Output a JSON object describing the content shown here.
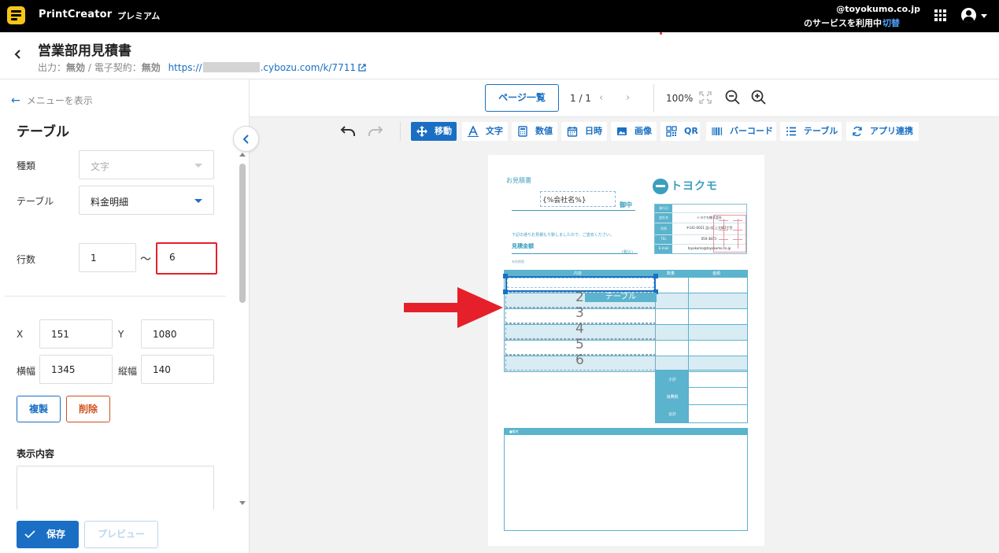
{
  "topbar": {
    "brand": "PrintCreator",
    "plan": "プレミアム",
    "user_email": "@toyokumo.co.jp",
    "service_text": "のサービスを利用中",
    "switch_label": "切替"
  },
  "header": {
    "title": "営業部用見積書",
    "output_label": "出力：",
    "output_value": "無効",
    "contract_label": " / 電子契約：",
    "contract_value": "無効",
    "url_prefix": "https://",
    "url_suffix": ".cybozu.com/k/7711"
  },
  "panel": {
    "menu_link": "メニューを表示",
    "title": "テーブル",
    "type_label": "種類",
    "type_value": "文字",
    "table_label": "テーブル",
    "table_value": "料金明細",
    "rows_label": "行数",
    "rows_from": "1",
    "rows_tilde": "〜",
    "rows_to": "6",
    "x_label": "X",
    "x_value": "151",
    "y_label": "Y",
    "y_value": "1080",
    "width_label": "横幅",
    "width_value": "1345",
    "height_label": "縦幅",
    "height_value": "140",
    "duplicate_label": "複製",
    "delete_label": "削除",
    "content_title": "表示内容",
    "save_label": "保存",
    "preview_label": "プレビュー"
  },
  "toolbar": {
    "pages_label": "ページ一覧",
    "page_count": "1 / 1",
    "zoom": "100%",
    "tools": [
      {
        "label": "移動",
        "icon": "move-icon",
        "active": true
      },
      {
        "label": "文字",
        "icon": "text-icon"
      },
      {
        "label": "数値",
        "icon": "calculator-icon"
      },
      {
        "label": "日時",
        "icon": "calendar-icon"
      },
      {
        "label": "画像",
        "icon": "image-icon"
      },
      {
        "label": "QR",
        "icon": "qr-icon"
      },
      {
        "label": "バーコード",
        "icon": "barcode-icon"
      },
      {
        "label": "テーブル",
        "icon": "list-icon"
      },
      {
        "label": "アプリ連携",
        "icon": "sync-icon"
      }
    ]
  },
  "document": {
    "title": "お見積書",
    "company_placeholder": "{%会社名%}",
    "honorific": "御中",
    "logo_text": "トヨクモ",
    "info": [
      {
        "key": "発行日",
        "value": ""
      },
      {
        "key": "会社名",
        "value": "トヨクモ株式会社"
      },
      {
        "key": "住所",
        "value": "〒141-0021 品川区上大崎2丁目"
      },
      {
        "key": "TEL",
        "value": "050-3815-"
      },
      {
        "key": "E-mail",
        "value": "toyokumo@toyokumo.co.jp"
      }
    ],
    "intro": "下記の通りお見積もり致しましたので、ご査収ください。",
    "estimate_label": "見積金額",
    "tax_note": "(税込)",
    "due_label": "有効期限",
    "table_headers": [
      "内容",
      "数量",
      "金額"
    ],
    "table_tag": "テーブル",
    "row_numbers": [
      "2",
      "3",
      "4",
      "5",
      "6"
    ],
    "summary": [
      "小計",
      "消費税",
      "合計"
    ],
    "notes_label": "■備考"
  },
  "colors": {
    "accent": "#1a6fc4",
    "doc_accent": "#3a9ebf",
    "highlight": "#e5202a",
    "delete": "#d0501e"
  }
}
